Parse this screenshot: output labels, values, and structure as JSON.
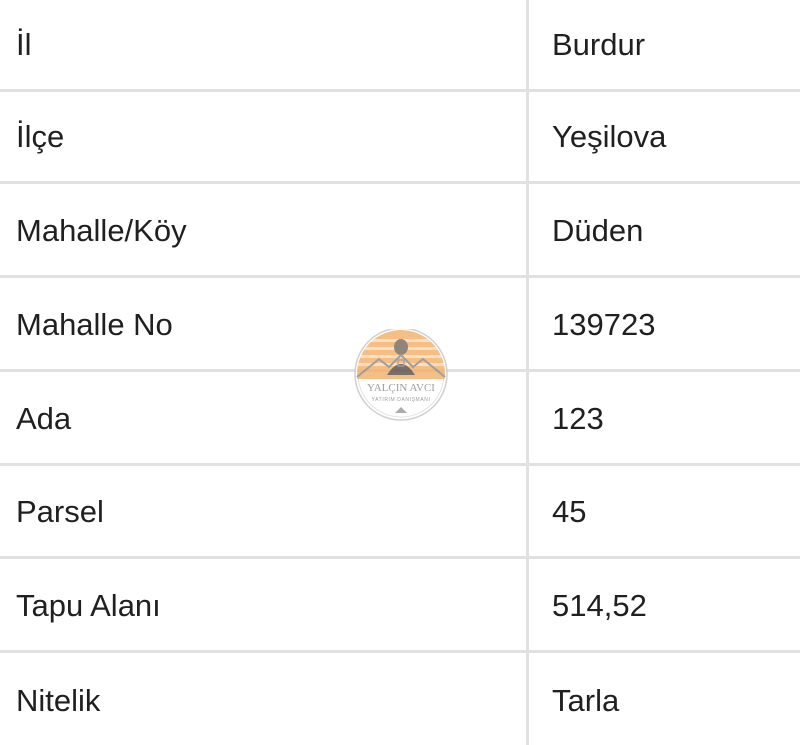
{
  "table": {
    "rows": [
      {
        "key": "İl",
        "value": "Burdur"
      },
      {
        "key": "İlçe",
        "value": "Yeşilova"
      },
      {
        "key": "Mahalle/Köy",
        "value": "Düden"
      },
      {
        "key": "Mahalle No",
        "value": "139723"
      },
      {
        "key": "Ada",
        "value": "123"
      },
      {
        "key": "Parsel",
        "value": "45"
      },
      {
        "key": "Tapu Alanı",
        "value": "514,52"
      },
      {
        "key": "Nitelik",
        "value": "Tarla"
      }
    ]
  },
  "watermark": {
    "name": "YALÇIN AVCI",
    "tagline": "YATIRIM DANIŞMANI",
    "colors": {
      "sun": "#f0a35a",
      "ring": "#b0b0b0",
      "text": "#8a8a8a"
    }
  }
}
